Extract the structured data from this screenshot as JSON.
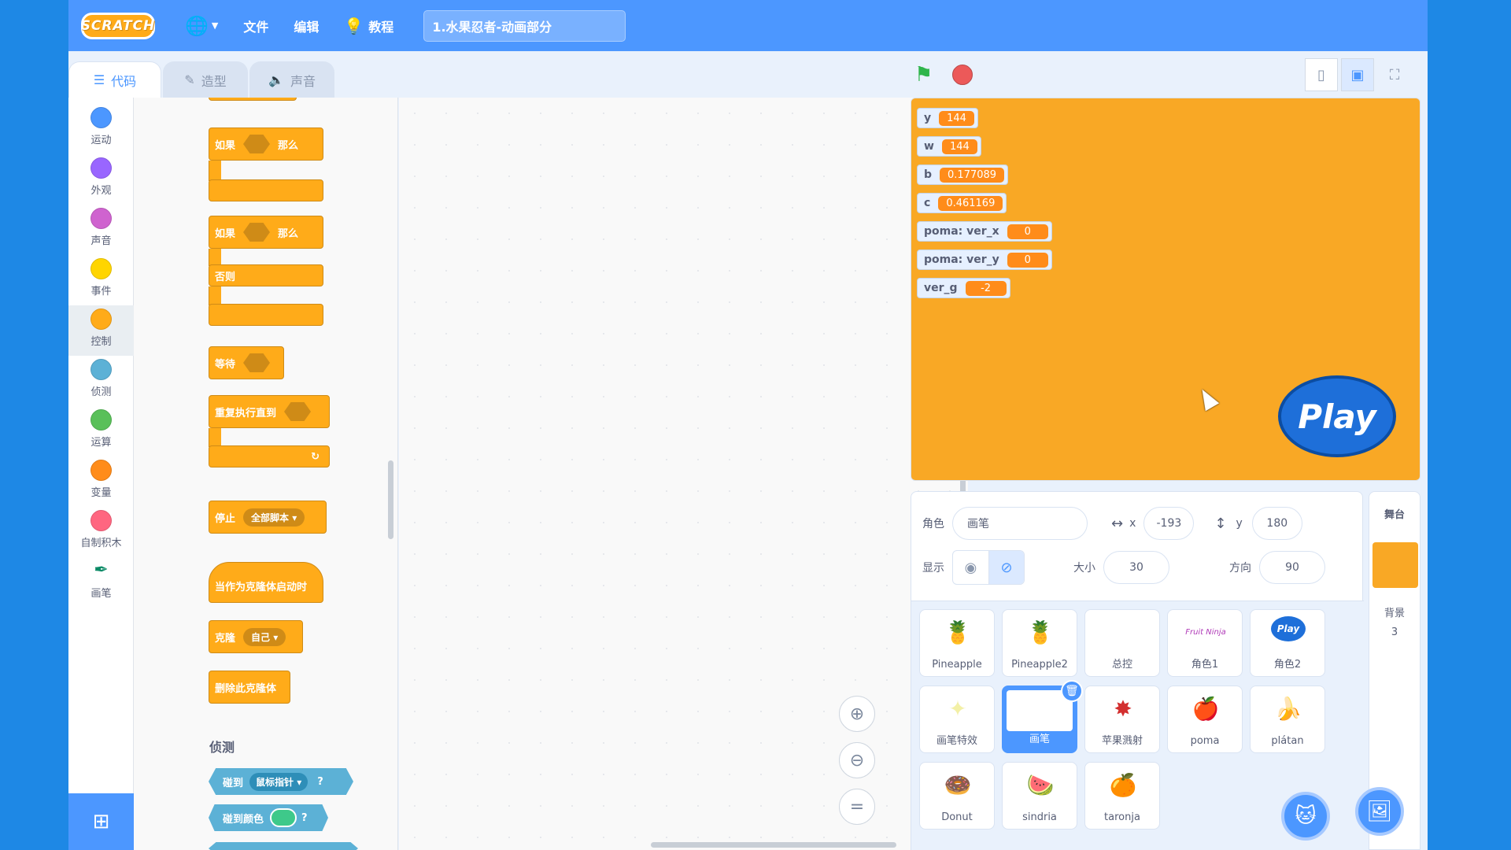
{
  "menubar": {
    "logo": "SCRATCH",
    "globe_icon": "globe-icon",
    "file": "文件",
    "edit": "编辑",
    "tutorials": "教程",
    "project_title": "1.水果忍者-动画部分"
  },
  "tabs": [
    {
      "label": "代码",
      "icon": "code-icon"
    },
    {
      "label": "造型",
      "icon": "brush-icon"
    },
    {
      "label": "声音",
      "icon": "speaker-icon"
    }
  ],
  "categories": [
    {
      "label": "运动",
      "color": "#4c97ff"
    },
    {
      "label": "外观",
      "color": "#9966ff"
    },
    {
      "label": "声音",
      "color": "#cf63cf"
    },
    {
      "label": "事件",
      "color": "#ffd500"
    },
    {
      "label": "控制",
      "color": "#ffab19"
    },
    {
      "label": "侦测",
      "color": "#5cb1d6"
    },
    {
      "label": "运算",
      "color": "#59c059"
    },
    {
      "label": "变量",
      "color": "#ff8c1a"
    },
    {
      "label": "自制积木",
      "color": "#ff6680"
    },
    {
      "label": "画笔",
      "color": "#0fbd8c"
    }
  ],
  "palette": {
    "if_label": "如果",
    "then_label": "那么",
    "else_label": "否则",
    "wait_label": "等待",
    "repeat_until_label": "重复执行直到",
    "stop_label": "停止",
    "stop_option": "全部脚本",
    "when_clone_label": "当作为克隆体启动时",
    "clone_label": "克隆",
    "clone_option": "自己",
    "delete_clone_label": "删除此克隆体",
    "sensing_title": "侦测",
    "touching_label": "碰到",
    "touching_option": "鼠标指针",
    "touching_color_label": "碰到颜色",
    "question_mark": "?"
  },
  "stage": {
    "monitors": [
      {
        "name": "y",
        "value": "144"
      },
      {
        "name": "w",
        "value": "144"
      },
      {
        "name": "b",
        "value": "0.177089"
      },
      {
        "name": "c",
        "value": "0.461169"
      },
      {
        "name": "poma: ver_x",
        "value": "0"
      },
      {
        "name": "poma: ver_y",
        "value": "0"
      },
      {
        "name": "ver_g",
        "value": "-2"
      }
    ],
    "play_button": "Play",
    "background_color": "#f9a825"
  },
  "sprite_info": {
    "sprite_label": "角色",
    "sprite_name": "画笔",
    "x_label": "x",
    "x_value": "-193",
    "y_label": "y",
    "y_value": "180",
    "show_label": "显示",
    "size_label": "大小",
    "size_value": "30",
    "direction_label": "方向",
    "direction_value": "90"
  },
  "sprites": [
    {
      "name": "Pineapple",
      "icon": "pineapple-icon"
    },
    {
      "name": "Pineapple2",
      "icon": "pineapple-icon"
    },
    {
      "name": "总控",
      "icon": ""
    },
    {
      "name": "角色1",
      "icon": "fruit-ninja-logo-icon"
    },
    {
      "name": "角色2",
      "icon": "play-icon"
    },
    {
      "name": "画笔特效",
      "icon": "sparkle-icon"
    },
    {
      "name": "画笔",
      "icon": ""
    },
    {
      "name": "苹果溅射",
      "icon": "splash-icon"
    },
    {
      "name": "poma",
      "icon": "apple-icon"
    },
    {
      "name": "plátan",
      "icon": "banana-icon"
    },
    {
      "name": "Donut",
      "icon": "donut-icon"
    },
    {
      "name": "sindria",
      "icon": "watermelon-icon"
    },
    {
      "name": "taronja",
      "icon": "orange-icon"
    }
  ],
  "stage_target": {
    "title": "舞台",
    "backdrops_label": "背景",
    "backdrops_count": "3"
  }
}
